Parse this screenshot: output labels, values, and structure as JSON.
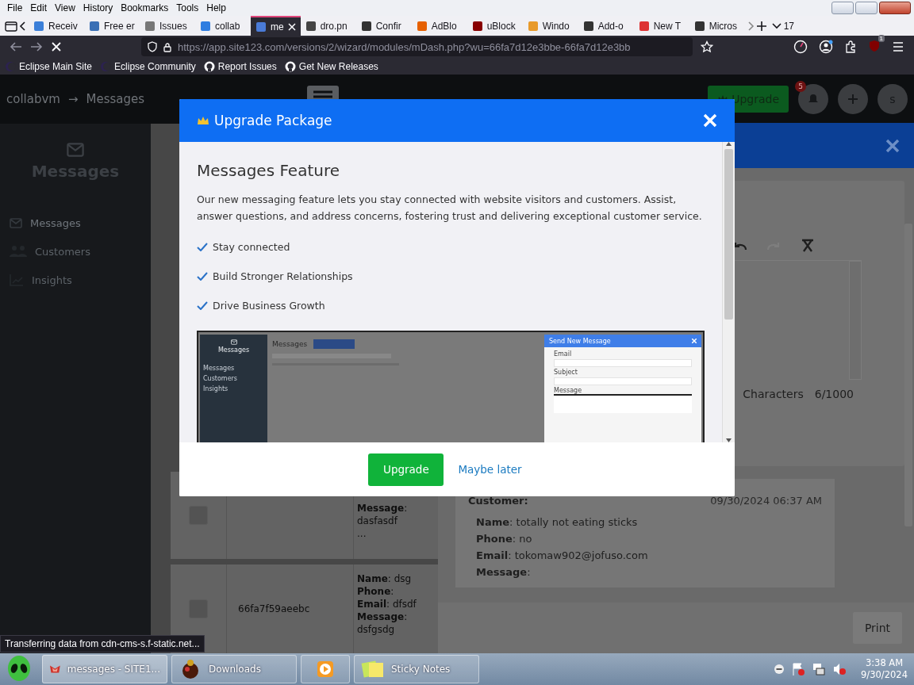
{
  "browser": {
    "menu": [
      "File",
      "Edit",
      "View",
      "History",
      "Bookmarks",
      "Tools",
      "Help"
    ],
    "tabs": [
      {
        "label": "Receiv",
        "selected": false
      },
      {
        "label": "Free er",
        "selected": false
      },
      {
        "label": "Issues",
        "selected": false
      },
      {
        "label": "collab",
        "selected": false
      },
      {
        "label": "me",
        "selected": true
      },
      {
        "label": "dro.pn",
        "selected": false
      },
      {
        "label": "Confir",
        "selected": false
      },
      {
        "label": "AdBlo",
        "selected": false
      },
      {
        "label": "uBlock",
        "selected": false
      },
      {
        "label": "Windo",
        "selected": false
      },
      {
        "label": "Add-o",
        "selected": false
      },
      {
        "label": "New T",
        "selected": false
      },
      {
        "label": "Micros",
        "selected": false
      }
    ],
    "tab_count": "17",
    "address": "https://app.site123.com/versions/2/wizard/modules/mDash.php?wu=66fa7d12e3bbe-66fa7d12e3bb",
    "extension_badge": "1",
    "bookmarks": [
      "Eclipse Main Site",
      "Eclipse Community",
      "Report Issues",
      "Get New Releases"
    ]
  },
  "site": {
    "breadcrumb": [
      "collabvm",
      "→",
      "Messages"
    ],
    "upgrade": "Upgrade",
    "notifications": "5",
    "avatar": "s"
  },
  "sidebar": {
    "title": "Messages",
    "items": [
      {
        "label": "Messages",
        "selected": true
      },
      {
        "label": "Customers",
        "selected": false
      },
      {
        "label": "Insights",
        "selected": false
      }
    ]
  },
  "table_rows": [
    {
      "checked": false,
      "column_3": [
        "**Message**:",
        "dasfasdf",
        "..."
      ]
    },
    {
      "checked": false,
      "column_2": "66fa7f59aeebc",
      "column_3": [
        "**Name**: dsg",
        "**Phone**:",
        "**Email**: dfsdf",
        "**Message**:",
        "dsfgsdg"
      ]
    }
  ],
  "detail": {
    "characters_label": "Characters",
    "characters_count": "6/1000",
    "customer_label": "Customer:",
    "date": "09/30/2024 06:37 AM",
    "lines": [
      "**Name**: totally not eating sticks",
      "**Phone**: no",
      "**Email**: tokomaw902@jofuso.com",
      "**Message**:"
    ],
    "print": "Print"
  },
  "modal": {
    "title": "Upgrade Package",
    "heading": "Messages Feature",
    "text": "Our new messaging feature lets you stay connected with website visitors and customers. Assist, answer questions, and address concerns, fostering trust and delivering exceptional customer service.",
    "features": [
      "Stay connected",
      "Build Stronger Relationships",
      "Drive Business Growth"
    ],
    "preview": {
      "sidebar_title": "Messages",
      "nav": [
        "Messages",
        "Customers",
        "Insights"
      ],
      "heading": "Messages",
      "dialog_title": "Send New Message",
      "fields": [
        "Email",
        "Subject",
        "Message"
      ]
    },
    "primary_button": "Upgrade",
    "secondary_link": "Maybe later"
  },
  "status": "Transferring data from cdn-cms-s.f-static.net...",
  "taskbar": {
    "items": [
      {
        "kind": "app",
        "label": "messages - SITE1...",
        "selected": true
      },
      {
        "kind": "app",
        "label": "Downloads",
        "selected": false
      },
      {
        "kind": "icon",
        "selected": false
      },
      {
        "kind": "app",
        "label": "Sticky Notes",
        "selected": false
      }
    ],
    "time": "3:38 AM",
    "date": "9/30/2024"
  }
}
